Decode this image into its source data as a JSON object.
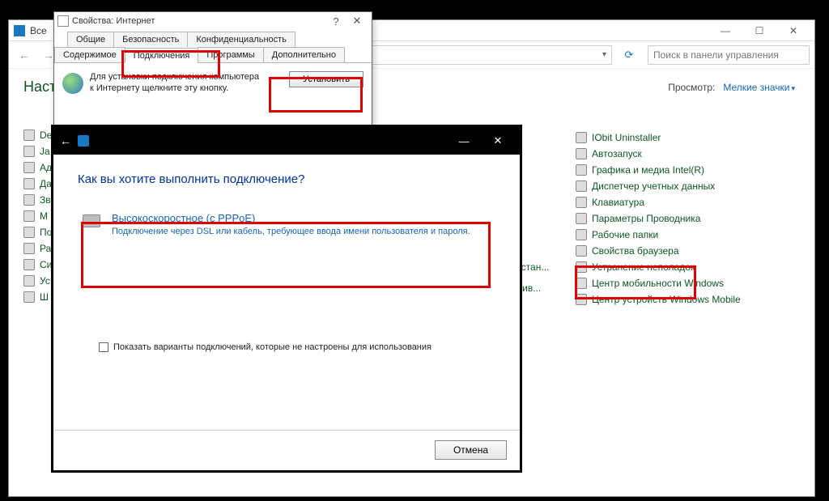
{
  "controlPanel": {
    "titlePrefix": "Все",
    "winbtns": {
      "min": "—",
      "max": "☐",
      "close": "✕"
    },
    "nav": {
      "back": "←",
      "fwd": "→",
      "up": "↑",
      "refresh": "⟳"
    },
    "addressVisible": "",
    "searchPlaceholder": "Поиск в панели управления",
    "heading": "Настро",
    "viewLabel": "Просмотр:",
    "viewValue": "Мелкие значки",
    "col1": [
      "De",
      "Ja",
      "Ад",
      "Да",
      "Зв",
      "М",
      "По",
      "Ра",
      "Си",
      "Ус",
      "Ш"
    ],
    "midItems": [
      "осстан...",
      "ужив...",
      ""
    ],
    "col3": [
      "IObit Uninstaller",
      "Автозапуск",
      "Графика и медиа Intel(R)",
      "Диспетчер учетных данных",
      "Клавиатура",
      "Параметры Проводника",
      "Рабочие папки",
      "Свойства браузера",
      "Устранение неполадок",
      "Центр мобильности Windows",
      "Центр устройств Windows Mobile"
    ]
  },
  "props": {
    "title": "Свойства: Интернет",
    "help": "?",
    "close": "✕",
    "tabsRow1": [
      "Общие",
      "Безопасность",
      "Конфиденциальность"
    ],
    "tabsRow2": [
      "Содержимое",
      "Подключения",
      "Программы",
      "Дополнительно"
    ],
    "activeTab": "Подключения",
    "bodyText1": "Для установки подключения компьютера",
    "bodyText2": "к Интернету щелкните эту кнопку.",
    "setupBtn": "Установить"
  },
  "wizard": {
    "back": "←",
    "min": "—",
    "close": "✕",
    "heading": "Как вы хотите выполнить подключение?",
    "option": {
      "title": "Высокоскоростное (с PPPoE)",
      "sub": "Подключение через DSL или кабель, требующее ввода имени пользователя и пароля."
    },
    "checkLabel": "Показать варианты подключений, которые не настроены для использования",
    "cancel": "Отмена"
  }
}
